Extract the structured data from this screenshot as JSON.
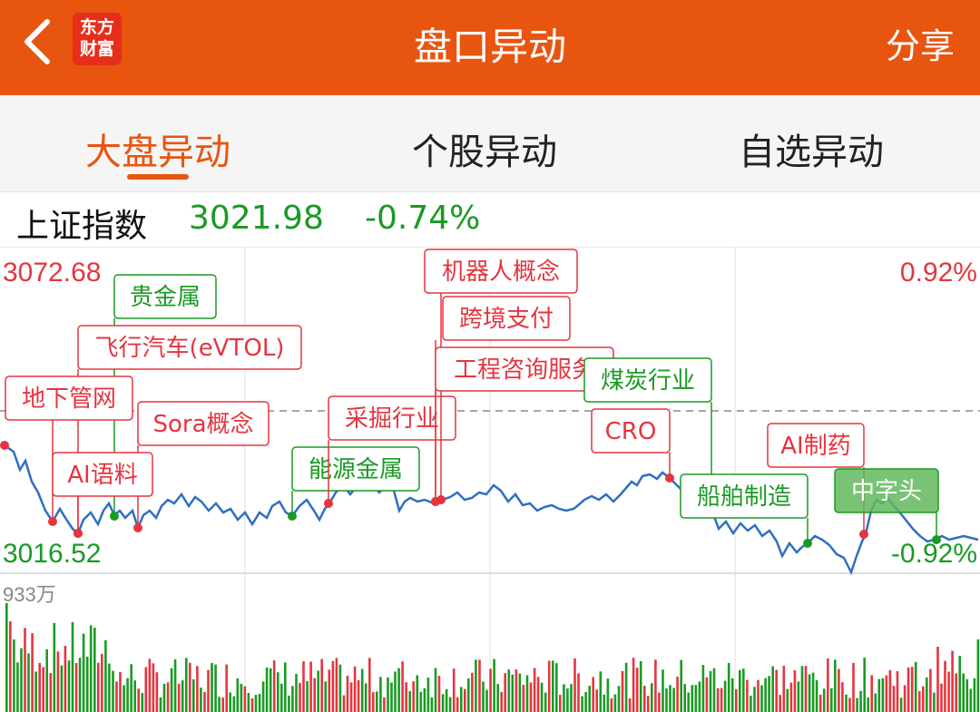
{
  "header": {
    "title": "盘口异动",
    "share_label": "分享",
    "logo_line1": "东方",
    "logo_line2": "财富"
  },
  "tabs": [
    {
      "label": "大盘异动",
      "active": true
    },
    {
      "label": "个股异动",
      "active": false
    },
    {
      "label": "自选异动",
      "active": false
    }
  ],
  "index": {
    "name": "上证指数",
    "value": "3021.98",
    "change_pct": "-0.74%"
  },
  "chart_data": {
    "type": "line",
    "y_high_label": "3072.68",
    "y_low_label": "3016.52",
    "pct_high_label": "0.92%",
    "pct_low_label": "-0.92%",
    "volume_max_label": "933万",
    "annotations": [
      {
        "label": "贵金属",
        "color": "green"
      },
      {
        "label": "飞行汽车(eVTOL)",
        "color": "red"
      },
      {
        "label": "地下管网",
        "color": "red"
      },
      {
        "label": "Sora概念",
        "color": "red"
      },
      {
        "label": "AI语料",
        "color": "red"
      },
      {
        "label": "能源金属",
        "color": "green"
      },
      {
        "label": "采掘行业",
        "color": "red"
      },
      {
        "label": "机器人概念",
        "color": "red"
      },
      {
        "label": "跨境支付",
        "color": "red"
      },
      {
        "label": "工程咨询服务",
        "color": "red"
      },
      {
        "label": "煤炭行业",
        "color": "green"
      },
      {
        "label": "CRO",
        "color": "red"
      },
      {
        "label": "AI制药",
        "color": "red"
      },
      {
        "label": "船舶制造",
        "color": "green"
      },
      {
        "label": "中字头",
        "color": "green"
      }
    ],
    "colors": {
      "up": "#e5353f",
      "down": "#1a9a24",
      "line": "#2f6fc4",
      "accent": "#E8550F"
    }
  }
}
